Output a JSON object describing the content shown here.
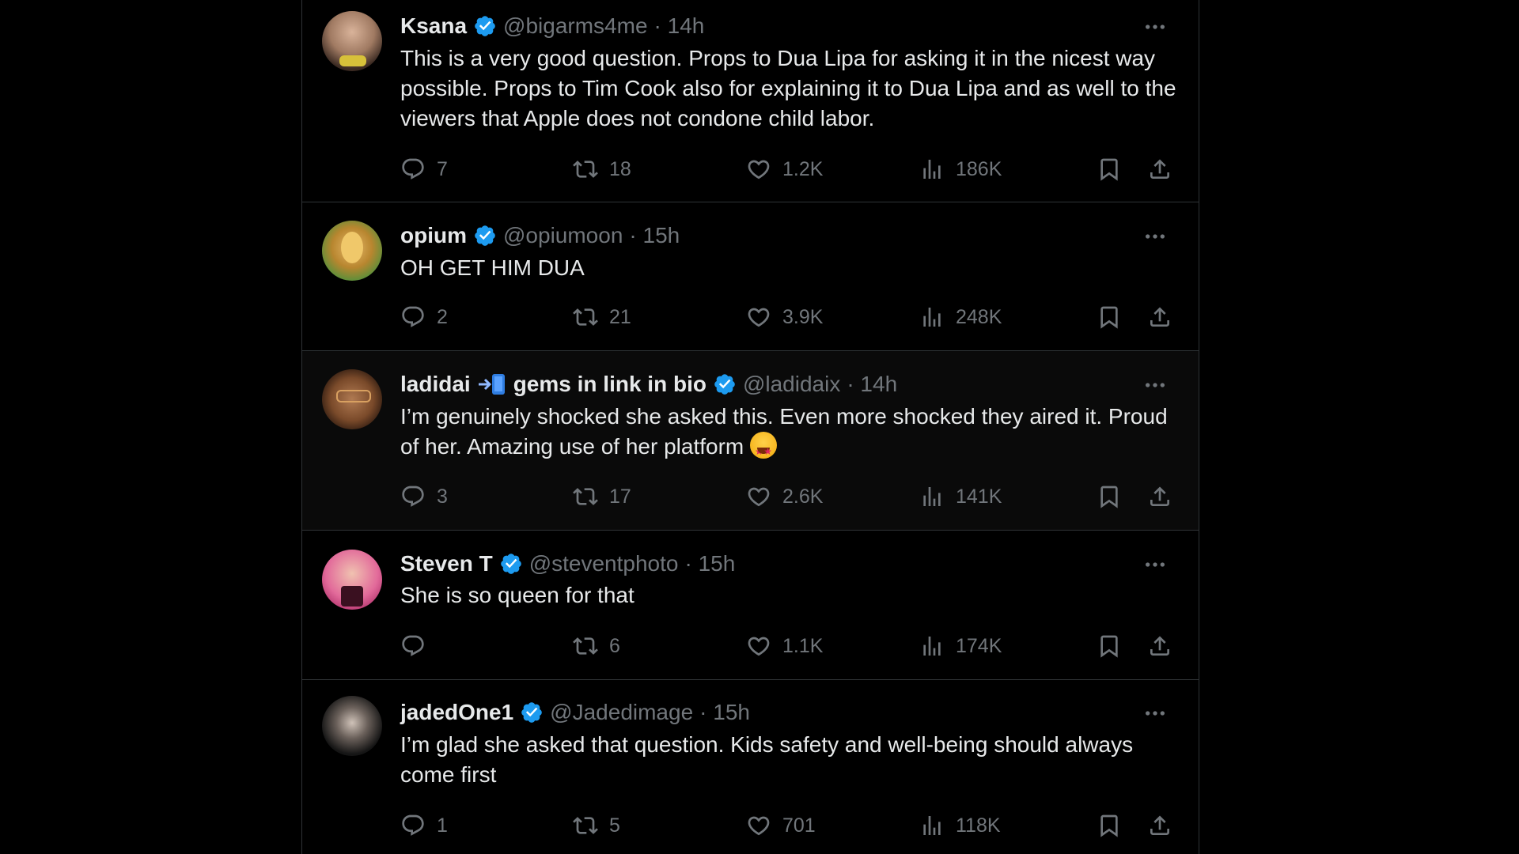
{
  "tweets": [
    {
      "name": "Ksana",
      "handle": "@bigarms4me",
      "time": "· 14h",
      "text": "This is a very good question. Props to Dua Lipa for asking it in the nicest way possible. Props to Tim Cook also for explaining it to Dua Lipa and as well to the viewers that Apple does not condone child labor.",
      "replies": "7",
      "retweets": "18",
      "likes": "1.2K",
      "views": "186K"
    },
    {
      "name": "opium",
      "handle": "@opiumoon",
      "time": "· 15h",
      "text": "OH GET HIM DUA",
      "replies": "2",
      "retweets": "21",
      "likes": "3.9K",
      "views": "248K"
    },
    {
      "name_part1": "ladidai",
      "name_part2": "gems in link in bio",
      "handle": "@ladidaix",
      "time": "· 14h",
      "text": "I’m genuinely shocked she asked this. Even more shocked they aired it. Proud of her. Amazing use of her platform",
      "replies": "3",
      "retweets": "17",
      "likes": "2.6K",
      "views": "141K"
    },
    {
      "name": "Steven T",
      "handle": "@steventphoto",
      "time": "· 15h",
      "text": "She is so queen for that",
      "replies": "",
      "retweets": "6",
      "likes": "1.1K",
      "views": "174K"
    },
    {
      "name": "jadedOne1",
      "handle": "@Jadedimage",
      "time": "· 15h",
      "text": "I’m glad she asked that question. Kids safety and well-being should always come first",
      "replies": "1",
      "retweets": "5",
      "likes": "701",
      "views": "118K"
    }
  ],
  "colors": {
    "background": "#000000",
    "text": "#e7e9ea",
    "muted": "#71767b",
    "border": "#2f3336",
    "verified": "#1d9bf0"
  },
  "icons": [
    "reply-icon",
    "retweet-icon",
    "like-icon",
    "views-icon",
    "bookmark-icon",
    "share-icon",
    "more-icon",
    "verified-badge-icon"
  ]
}
